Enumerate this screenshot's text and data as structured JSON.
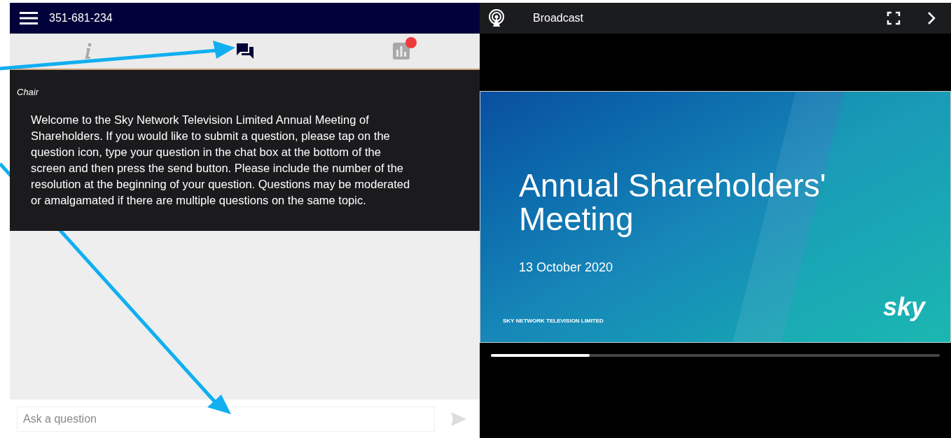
{
  "header": {
    "meeting_id": "351-681-234"
  },
  "tabs": [
    {
      "kind": "info",
      "selected": false,
      "notification": false
    },
    {
      "kind": "chat",
      "selected": true,
      "notification": false
    },
    {
      "kind": "poll",
      "selected": false,
      "notification": true
    }
  ],
  "messages": [
    {
      "author": "Chair",
      "text": "Welcome to the Sky Network Television Limited Annual Meeting of Shareholders. If you would like to submit a question, please tap on the question icon, type your question in the chat box at the bottom of the screen and then press the send button. Please include the number of the resolution at the beginning of your question. Questions may be moderated or amalgamated if there are multiple questions on the same topic."
    }
  ],
  "question_input": {
    "placeholder": "Ask a question"
  },
  "broadcast": {
    "title": "Broadcast",
    "slide": {
      "title": "Annual Shareholders' Meeting",
      "date": "13 October 2020",
      "company": "SKY NETWORK TELEVISION LIMITED",
      "logo": "sky"
    },
    "progress": {
      "level": 0.22
    }
  }
}
